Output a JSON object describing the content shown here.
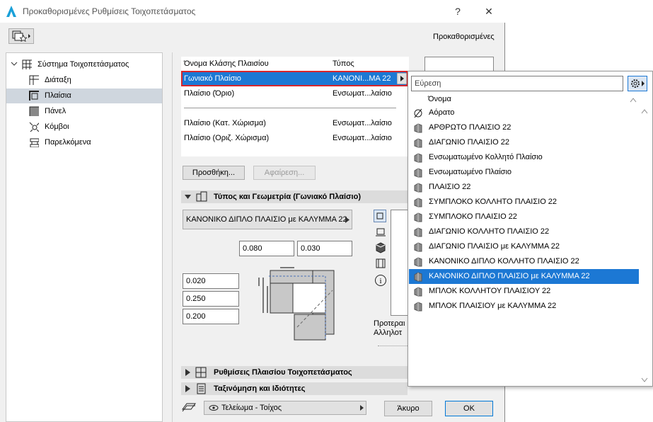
{
  "window": {
    "title": "Προκαθορισμένες Ρυθμίσεις Τοιχοπετάσματος",
    "help": "?",
    "close": "✕",
    "favorites_label": "Προκαθορισμένες"
  },
  "tree": {
    "root": "Σύστημα Τοιχοπετάσματος",
    "items": [
      "Διάταξη",
      "Πλαίσια",
      "Πάνελ",
      "Κόμβοι",
      "Παρελκόμενα"
    ]
  },
  "frames_list": {
    "col_name": "Όνομα Κλάσης Πλαισίου",
    "col_type": "Τύπος",
    "rows": [
      {
        "name": "Γωνιακό Πλαίσιο",
        "type": "ΚΑΝΟΝΙ...ΜΑ 22"
      },
      {
        "name": "Πλαίσιο (Όριο)",
        "type": "Ενσωματ...λαίσιο"
      },
      {
        "name": "Πλαίσιο (Κατ. Χώρισμα)",
        "type": "Ενσωματ...λαίσιο"
      },
      {
        "name": "Πλαίσιο (Οριζ. Χώρισμα)",
        "type": "Ενσωματ...λαίσιο"
      }
    ],
    "add_label": "Προσθήκη...",
    "remove_label": "Αφαίρεση..."
  },
  "type_geometry": {
    "header": "Τύπος και Γεωμετρία (Γωνιακό Πλαίσιο)",
    "type_value": "ΚΑΝΟΝΙΚΟ ΔΙΠΛΟ ΠΛΑΙΣΙΟ με ΚΑΛΥΜΜΑ 22",
    "dim_a": "0.080",
    "dim_b": "0.030",
    "dim_c": "0.020",
    "dim_d": "0.250",
    "dim_e": "0.200",
    "cut_text_1": "Προτεραι",
    "cut_text_2": "Αλληλοτ"
  },
  "sections": {
    "frame_settings": "Ρυθμίσεις Πλαισίου Τοιχοπετάσματος",
    "classification": "Ταξινόμηση και Ιδιότητες"
  },
  "footer": {
    "surface": "Τελείωμα - Τοίχος",
    "cancel": "Άκυρο",
    "ok": "OK"
  },
  "popup": {
    "search_placeholder": "Εύρεση",
    "col_name": "Όνομα",
    "items": [
      "Αόρατο",
      "ΑΡΘΡΩΤΟ ΠΛΑΙΣΙΟ 22",
      "ΔΙΑΓΩΝΙΟ ΠΛΑΙΣΙΟ 22",
      "Ενσωματωμένο Κολλητό Πλαίσιο",
      "Ενσωματωμένο Πλαίσιο",
      "ΠΛΑΙΣΙΟ 22",
      "ΣΥΜΠΛΟΚΟ ΚΟΛΛΗΤΟ ΠΛΑΙΣΙΟ 22",
      "ΣΥΜΠΛΟΚΟ ΠΛΑΙΣΙΟ 22",
      "ΔΙΑΓΩΝΙΟ ΚΟΛΛΗΤΟ ΠΛΑΙΣΙΟ 22",
      "ΔΙΑΓΩΝΙΟ ΠΛΑΙΣΙΟ με ΚΑΛΥΜΜΑ 22",
      "ΚΑΝΟΝΙΚΟ ΔΙΠΛΟ ΚΟΛΛΗΤΟ ΠΛΑΙΣΙΟ 22",
      "ΚΑΝΟΝΙΚΟ ΔΙΠΛΟ ΠΛΑΙΣΙΟ με ΚΑΛΥΜΜΑ 22",
      "ΜΠΛΟΚ ΚΟΛΛΗΤΟΥ ΠΛΑΙΣΙΟΥ 22",
      "ΜΠΛΟΚ ΠΛΑΙΣΙΟΥ με ΚΑΛΥΜΜΑ 22"
    ],
    "selected_index": 11
  },
  "colors": {
    "selection": "#1c78d4",
    "highlight_border": "#d9262b"
  }
}
